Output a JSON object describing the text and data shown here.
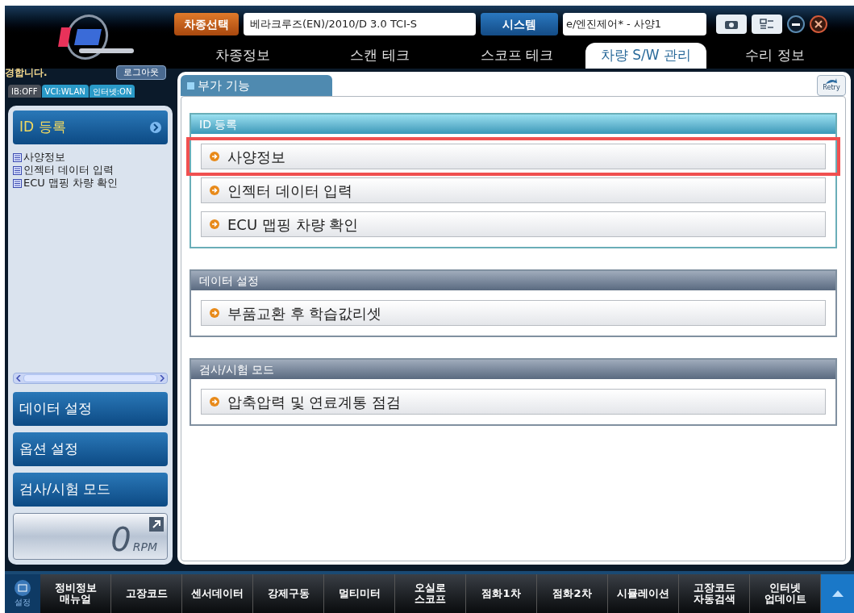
{
  "header": {
    "vehicle_button": "차종선택",
    "vehicle_value": "베라크루즈(EN)/2010/D 3.0 TCI-S",
    "system_button": "시스템",
    "system_value": "e/엔진제어* - 사양1"
  },
  "tabs": [
    {
      "label": "차종정보",
      "selected": false
    },
    {
      "label": "스캔 테크",
      "selected": false
    },
    {
      "label": "스코프 테크",
      "selected": false
    },
    {
      "label": "차량 S/W 관리",
      "selected": true
    },
    {
      "label": "수리 정보",
      "selected": false
    }
  ],
  "user": {
    "greeting": "경합니다.",
    "logout": "로그아웃"
  },
  "status": [
    {
      "label": "IB:OFF",
      "on": false
    },
    {
      "label": "VCI:WLAN",
      "on": true
    },
    {
      "label": "인터넷:ON",
      "on": true
    }
  ],
  "sidebar": {
    "sections": [
      {
        "label": "ID 등록",
        "expanded": true,
        "items": [
          "사양정보",
          "인젝터 데이터 입력",
          "ECU 맵핑 차량 확인"
        ]
      },
      {
        "label": "데이터 설정",
        "expanded": false
      },
      {
        "label": "옵션 설정",
        "expanded": false
      },
      {
        "label": "검사/시험 모드",
        "expanded": false
      }
    ],
    "rpm": "0",
    "rpm_unit": "RPM"
  },
  "panel": {
    "title": "부가 기능",
    "retry": "Retry",
    "groups": [
      {
        "title": "ID 등록",
        "kind": "active",
        "items": [
          {
            "label": "사양정보",
            "highlighted": true
          },
          {
            "label": "인젝터 데이터 입력",
            "highlighted": false
          },
          {
            "label": "ECU 맵핑 차량 확인",
            "highlighted": false
          }
        ]
      },
      {
        "title": "데이터 설정",
        "kind": "normal",
        "items": [
          {
            "label": "부품교환 후 학습값리셋",
            "highlighted": false
          }
        ]
      },
      {
        "title": "검사/시험 모드",
        "kind": "normal",
        "items": [
          {
            "label": "압축압력 및 연료계통 점검",
            "highlighted": false
          }
        ]
      }
    ]
  },
  "toolbar": {
    "settings": "설정",
    "buttons": [
      [
        "정비정보",
        "매뉴얼"
      ],
      [
        "고장코드"
      ],
      [
        "센서데이터"
      ],
      [
        "강제구동"
      ],
      [
        "멀티미터"
      ],
      [
        "오실로",
        "스코프"
      ],
      [
        "점화1차"
      ],
      [
        "점화2차"
      ],
      [
        "시뮬레이션"
      ],
      [
        "고장코드",
        "자동검색"
      ],
      [
        "인터넷",
        "업데이트"
      ]
    ]
  }
}
